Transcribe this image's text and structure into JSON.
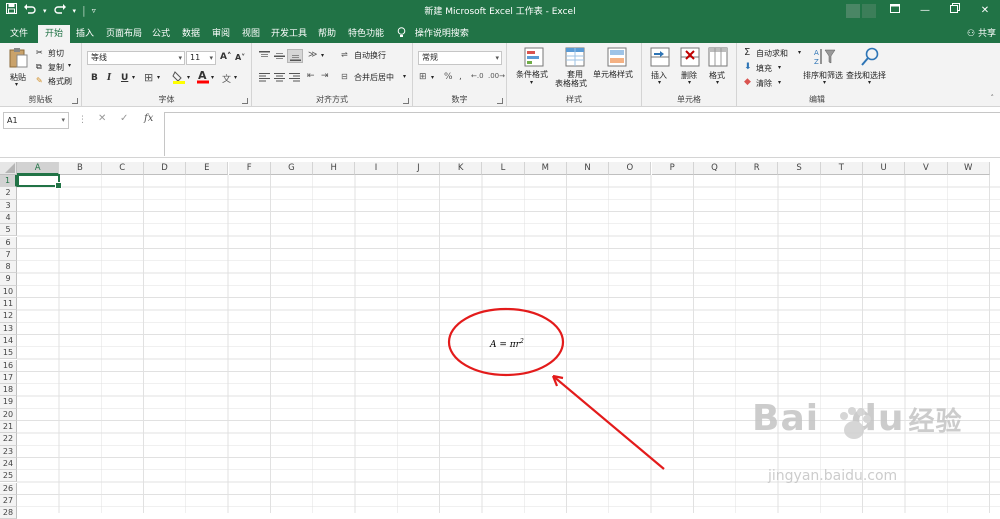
{
  "window": {
    "title": "新建 Microsoft Excel 工作表 - Excel"
  },
  "qat": {
    "save_icon": "save-icon",
    "undo_icon": "undo-icon",
    "redo_icon": "redo-icon",
    "customize_icon": "customize-qat-icon"
  },
  "tabs": [
    {
      "label": "文件"
    },
    {
      "label": "开始"
    },
    {
      "label": "插入"
    },
    {
      "label": "页面布局"
    },
    {
      "label": "公式"
    },
    {
      "label": "数据"
    },
    {
      "label": "审阅"
    },
    {
      "label": "视图"
    },
    {
      "label": "开发工具"
    },
    {
      "label": "帮助"
    },
    {
      "label": "特色功能"
    }
  ],
  "tell_me": "操作说明搜索",
  "share": "共享",
  "ribbon": {
    "clipboard": {
      "label": "剪贴板",
      "paste": "粘贴",
      "cut": "剪切",
      "copy": "复制",
      "format_painter": "格式刷"
    },
    "font": {
      "label": "字体",
      "font_name": "等线",
      "font_size": "11",
      "bold": "B",
      "italic": "I",
      "underline": "U"
    },
    "alignment": {
      "label": "对齐方式",
      "wrap": "自动换行",
      "merge": "合并后居中"
    },
    "number": {
      "label": "数字",
      "format": "常规"
    },
    "styles": {
      "label": "样式",
      "conditional": "条件格式",
      "table_l1": "套用",
      "table_l2": "表格格式",
      "cell_styles": "单元格样式"
    },
    "cells": {
      "label": "单元格",
      "insert": "插入",
      "delete": "删除",
      "format": "格式"
    },
    "editing": {
      "label": "编辑",
      "autosum": "自动求和",
      "fill": "填充",
      "clear": "清除",
      "sort": "排序和筛选",
      "find": "查找和选择"
    }
  },
  "formula_bar": {
    "name_box": "A1",
    "cancel": "✕",
    "enter": "✓",
    "fx": "fx",
    "value": ""
  },
  "columns": [
    "A",
    "B",
    "C",
    "D",
    "E",
    "F",
    "G",
    "H",
    "I",
    "J",
    "K",
    "L",
    "M",
    "N",
    "O",
    "P",
    "Q",
    "R",
    "S",
    "T",
    "U",
    "V",
    "W"
  ],
  "rows": [
    "1",
    "2",
    "3",
    "4",
    "5",
    "6",
    "7",
    "8",
    "9",
    "10",
    "11",
    "12",
    "13",
    "14",
    "15",
    "16",
    "17",
    "18",
    "19",
    "20",
    "21",
    "22",
    "23",
    "24",
    "25",
    "26",
    "27",
    "28"
  ],
  "equation": {
    "base": "A = πr",
    "exponent": "2"
  },
  "annotation": {
    "color": "#e31b1b"
  },
  "watermark": {
    "brand": "Bai",
    "brand2": "du",
    "cn": "经验",
    "url": "jingyan.baidu.com"
  },
  "colors": {
    "accent": "#217346"
  }
}
